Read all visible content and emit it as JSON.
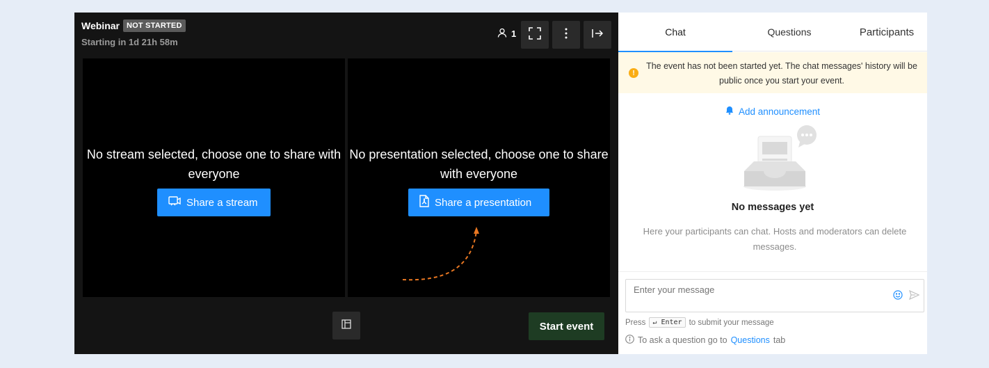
{
  "stage": {
    "title": "Webinar",
    "status_badge": "NOT STARTED",
    "starting_text": "Starting in 1d 21h 58m",
    "participant_count": "1",
    "stream_pane": {
      "message": "No stream selected, choose one to share with everyone",
      "button_label": "Share a stream"
    },
    "presentation_pane": {
      "message": "No presentation selected, choose one to share with everyone",
      "button_label": "Share a presentation"
    },
    "start_button": "Start event",
    "accent_color": "#1f8fff",
    "start_color": "#1e3c23"
  },
  "sidebar": {
    "tabs": [
      {
        "label": "Chat",
        "active": true
      },
      {
        "label": "Questions",
        "active": false
      },
      {
        "label": "Participants",
        "active": false
      }
    ],
    "notice": "The event has not been started yet. The chat messages' history will be public once you start your event.",
    "announce_label": "Add announcement",
    "empty_title": "No messages yet",
    "empty_desc": "Here your participants can chat. Hosts and moderators can delete messages.",
    "input_placeholder": "Enter your message",
    "hint_press": "Press",
    "hint_key": "↵ Enter",
    "hint_rest": "to submit your message",
    "ask_prefix": "To ask a question go to",
    "ask_link": "Questions",
    "ask_suffix": "tab"
  },
  "icons": [
    "user-icon",
    "fullscreen-icon",
    "more-vertical-icon",
    "leave-icon",
    "stream-icon",
    "pdf-icon",
    "layout-icon",
    "warning-icon",
    "bell-icon",
    "emoji-icon",
    "send-icon",
    "info-icon"
  ]
}
